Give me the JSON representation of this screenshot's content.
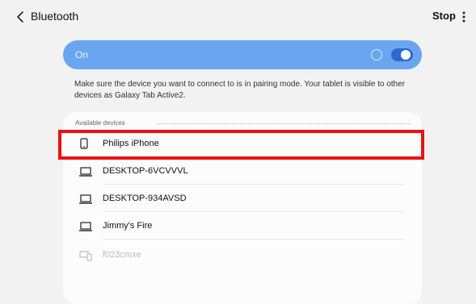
{
  "header": {
    "title": "Bluetooth",
    "stop_label": "Stop"
  },
  "toggle_card": {
    "label": "On",
    "enabled": true
  },
  "info_text": "Make sure the device you want to connect to is in pairing mode. Your tablet is visible to other devices as Galaxy Tab Active2.",
  "devices": {
    "section_label": "Available devices",
    "items": [
      {
        "label": "Philips iPhone",
        "icon": "phone-icon",
        "highlighted": true
      },
      {
        "label": "DESKTOP-6VCVVVL",
        "icon": "laptop-icon"
      },
      {
        "label": "DESKTOP-934AVSD",
        "icon": "laptop-icon"
      },
      {
        "label": "Jimmy's Fire",
        "icon": "laptop-icon"
      },
      {
        "label": "f023cmxe",
        "icon": "multi-device-icon",
        "faded": true
      }
    ]
  },
  "colors": {
    "toggle_card": "#6aa6f0",
    "toggle_track": "#2f66d0",
    "highlight": "#ea1111"
  }
}
